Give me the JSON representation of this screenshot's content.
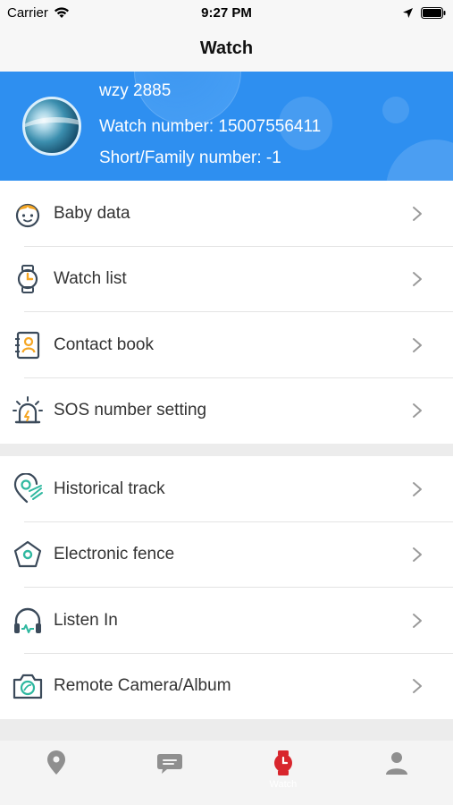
{
  "status_bar": {
    "carrier": "Carrier",
    "time": "9:27 PM"
  },
  "nav": {
    "title": "Watch"
  },
  "profile": {
    "name": "wzy 2885",
    "watch_number": "Watch number: 15007556411",
    "short_number": "Short/Family number: -1"
  },
  "group1": {
    "items": [
      {
        "label": "Baby data",
        "icon": "baby-face-icon"
      },
      {
        "label": "Watch list",
        "icon": "watch-icon"
      },
      {
        "label": "Contact book",
        "icon": "contact-book-icon"
      },
      {
        "label": "SOS number setting",
        "icon": "alarm-light-icon"
      }
    ]
  },
  "group2": {
    "items": [
      {
        "label": "Historical track",
        "icon": "location-track-icon"
      },
      {
        "label": "Electronic fence",
        "icon": "fence-pentagon-icon"
      },
      {
        "label": "Listen In",
        "icon": "headphones-icon"
      },
      {
        "label": "Remote Camera/Album",
        "icon": "camera-icon"
      }
    ]
  },
  "tab_bar": {
    "tabs": [
      {
        "icon": "location-pin-icon",
        "label": "",
        "active": false
      },
      {
        "icon": "chat-bubble-icon",
        "label": "",
        "active": false
      },
      {
        "icon": "watch-icon",
        "label": "Watch",
        "active": true
      },
      {
        "icon": "person-icon",
        "label": "",
        "active": false
      }
    ]
  },
  "colors": {
    "header_blue": "#2e8ff0",
    "icon_orange": "#f5a623",
    "icon_teal": "#2fb8a0",
    "icon_dark": "#3b4a5a",
    "tab_active": "#d8262d",
    "tab_inactive": "#8f8f8f"
  }
}
